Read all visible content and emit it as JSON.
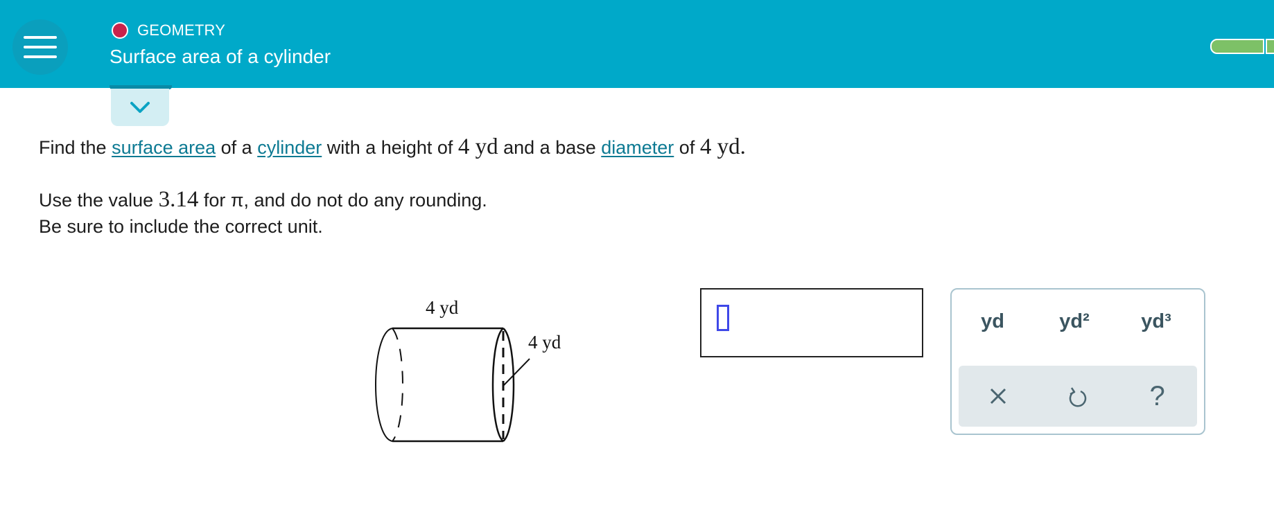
{
  "header": {
    "topic": "GEOMETRY",
    "title": "Surface area of a cylinder",
    "topic_dot_color": "#c8234b",
    "background_color": "#00a9c9",
    "progress_color": "#7dc167"
  },
  "question": {
    "line1": {
      "t1": "Find the ",
      "link1": "surface area",
      "t2": " of a ",
      "link2": "cylinder",
      "t3": " with a height of ",
      "height_value": "4 yd",
      "t4": " and a base ",
      "link3": "diameter",
      "t5": " of ",
      "diameter_value": "4 yd",
      "t6": "."
    },
    "line2": {
      "t1": "Use the value ",
      "pi_value": "3.14",
      "t2": " for π, and do not do any rounding."
    },
    "line3": "Be sure to include the correct unit."
  },
  "figure": {
    "top_label": "4 yd",
    "side_label": "4 yd"
  },
  "answer": {
    "value": ""
  },
  "keypad": {
    "units": [
      "yd",
      "yd²",
      "yd³"
    ],
    "tools": [
      "clear-icon",
      "undo-icon",
      "help-icon"
    ],
    "help_glyph": "?"
  }
}
